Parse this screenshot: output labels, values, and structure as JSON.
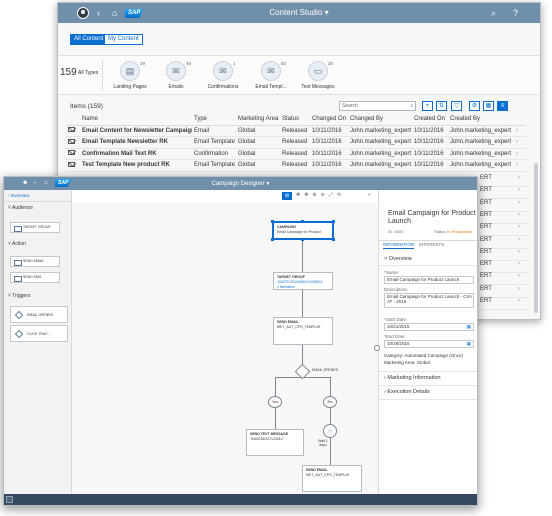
{
  "content_studio": {
    "title": "Content Studio",
    "brand": "SAP",
    "avatar_glyph": "☻",
    "seg_all": "All Content",
    "seg_my": "My Content",
    "total_count": "159",
    "total_label": "All Types",
    "kpis": [
      {
        "label": "Landing Pages",
        "count": "29",
        "icon": "landing-page-icon",
        "glyph": "▤"
      },
      {
        "label": "Emails",
        "count": "49",
        "icon": "email-icon",
        "glyph": "✉"
      },
      {
        "label": "Confirmations",
        "count": "1",
        "icon": "confirmation-icon",
        "glyph": "✉"
      },
      {
        "label": "Email Templ...",
        "count": "50",
        "icon": "email-template-icon",
        "glyph": "✉"
      },
      {
        "label": "Text Messages",
        "count": "30",
        "icon": "text-message-icon",
        "glyph": "▭"
      }
    ],
    "items_label": "Items (159)",
    "search_placeholder": "Search",
    "columns": [
      "Name",
      "Type",
      "Marketing Area",
      "Status",
      "Changed On",
      "Changed By",
      "Created On",
      "Created By"
    ],
    "rows": [
      [
        "Email Content for Newsletter Campaign",
        "Email",
        "Global",
        "Released",
        "10/11/2016",
        "John.marketing_expert",
        "10/11/2016",
        "John.marketing_expert"
      ],
      [
        "Email Template Newsletter RK",
        "Email Template",
        "Global",
        "Released",
        "10/11/2016",
        "John.marketing_expert",
        "10/11/2016",
        "John.marketing_expert"
      ],
      [
        "Confirmation Mail Text RK",
        "Confirmation",
        "Global",
        "Released",
        "10/11/2016",
        "John.marketing_expert",
        "10/11/2016",
        "John.marketing_expert"
      ],
      [
        "Test Template New product RK",
        "Email Template",
        "Global",
        "Released",
        "10/11/2016",
        "John.marketing_expert",
        "10/11/2016",
        "John.marketing_expert"
      ]
    ],
    "partial_right": [
      "ERT",
      "ERT",
      "ERT",
      "ERT",
      "ERT",
      "ERT",
      "ERT",
      "ERT",
      "ERT",
      "ERT",
      "ERT"
    ]
  },
  "campaign_designer": {
    "title": "Campaign Designer",
    "brand": "SAP",
    "back_label": "Overview",
    "sections": {
      "audience": "Audience",
      "action": "Action",
      "triggers": "Triggers"
    },
    "palette": {
      "target_group": "TARGET GROUP",
      "send_email": "SEND EMAIL",
      "send_sms": "SEND SMS",
      "email_opened": "EMAIL OPENED",
      "click_track": "CLICK TRAC..."
    },
    "nodes": {
      "campaign_tag": "CAMPAIGN",
      "campaign_name": "Email Campaign for Product",
      "tg_tag": "TARGET GROUP",
      "tg_name": "JAMTSYCD1608/19-00/0814",
      "tg_members": "1 Members",
      "se1_tag": "SEND EMAIL",
      "se1_name": "MKT_AUT_CPG_TEMPLAT",
      "email_opened": "EMAIL OPENED",
      "yes": "Yes",
      "no": "No",
      "wait_label": "Wait 1 days",
      "sms_tag": "SEND TEXT MESSAGE",
      "sms_name": "Text2016/027124912",
      "se2_tag": "SEND EMAIL",
      "se2_name": "MKT_AUT_CPG_TEMPLAT"
    },
    "panel": {
      "title": "Email Campaign for Product Launch",
      "id_label": "ID: 4803",
      "status_label": "Status:",
      "status_value": "In Preparation",
      "tab_info": "INFORMATION",
      "tab_interests": "INTERESTS",
      "overview": "Overview",
      "name_label": "*Name:",
      "name_value": "Email Campaign for Product Launch",
      "desc_label": "Description:",
      "desc_value": "Email Campaign for Product Launch - Crm AT - 2016",
      "start_label": "*Start Date:",
      "start_value": "10/21/2016",
      "end_label": "*End Date:",
      "end_value": "10/28/2016",
      "category": "Category: Automated Campaign (Once)",
      "marketing_area": "Marketing Area: Global",
      "mkt_info": "Marketing Information",
      "exec_details": "Execution Details"
    },
    "accent": "#0a6ed1",
    "shell_color": "#6f8faa",
    "status_color": "#e9730c"
  }
}
